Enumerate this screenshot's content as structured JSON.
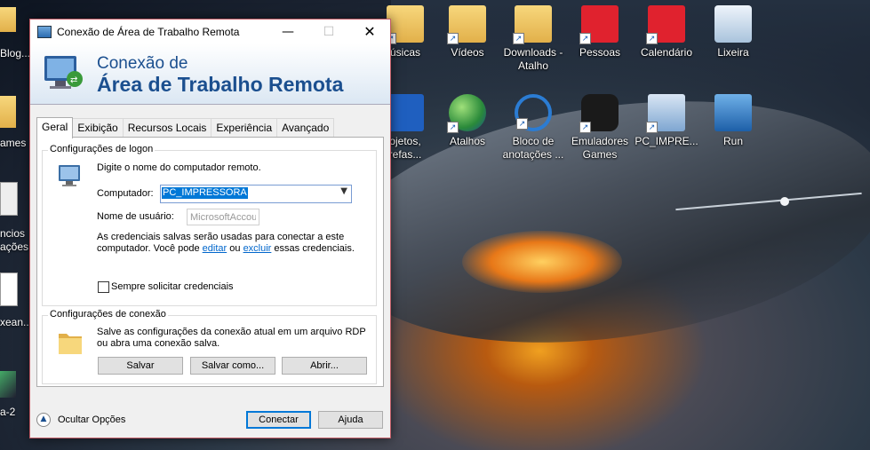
{
  "desktop": {
    "left_labels": [
      "Blog...",
      "ames",
      "ncios",
      "ações",
      "xean...",
      "a-2"
    ],
    "icons": [
      {
        "label": "úsicas",
        "icon": "music-folder-icon"
      },
      {
        "label": "Vídeos",
        "icon": "video-folder-icon"
      },
      {
        "label": "Downloads - Atalho",
        "icon": "downloads-folder-icon"
      },
      {
        "label": "Pessoas",
        "icon": "people-icon"
      },
      {
        "label": "Calendário",
        "icon": "calendar-icon"
      },
      {
        "label": "Lixeira",
        "icon": "recycle-bin-icon"
      },
      {
        "label": "ojetos, refas...",
        "icon": "projects-icon"
      },
      {
        "label": "Atalhos",
        "icon": "globe-shortcut-icon"
      },
      {
        "label": "Bloco de anotações ...",
        "icon": "notepad-shortcut-icon"
      },
      {
        "label": "Emuladores Games",
        "icon": "gamepad-icon"
      },
      {
        "label": "PC_IMPRE...",
        "icon": "pc-shortcut-icon"
      },
      {
        "label": "Run",
        "icon": "run-icon"
      }
    ]
  },
  "dialog": {
    "title": "Conexão de Área de Trabalho Remota",
    "banner_line1": "Conexão de",
    "banner_line2": "Área de Trabalho Remota",
    "tabs": [
      "Geral",
      "Exibição",
      "Recursos Locais",
      "Experiência",
      "Avançado"
    ],
    "active_tab": "Geral",
    "logon": {
      "group_title": "Configurações de logon",
      "instruction": "Digite o nome do computador remoto.",
      "computer_label": "Computador:",
      "computer_value": "PC_IMPRESSORA",
      "username_label": "Nome de usuário:",
      "username_value": "MicrosoftAccour",
      "cred_text_1": "As credenciais salvas serão usadas para conectar a este",
      "cred_text_2a": "computador. Você pode",
      "cred_link_edit": "editar",
      "cred_text_2b": "ou",
      "cred_link_delete": "excluir",
      "cred_text_2c": "essas credenciais.",
      "always_ask_label": "Sempre solicitar credenciais",
      "always_ask_checked": false
    },
    "connection": {
      "group_title": "Configurações de conexão",
      "text_1": "Salve as configurações da conexão atual em um arquivo RDP",
      "text_2": "ou abra uma conexão salva.",
      "save_label": "Salvar",
      "save_as_label": "Salvar como...",
      "open_label": "Abrir..."
    },
    "hide_options_label": "Ocultar Opções",
    "connect_label": "Conectar",
    "help_label": "Ajuda"
  }
}
